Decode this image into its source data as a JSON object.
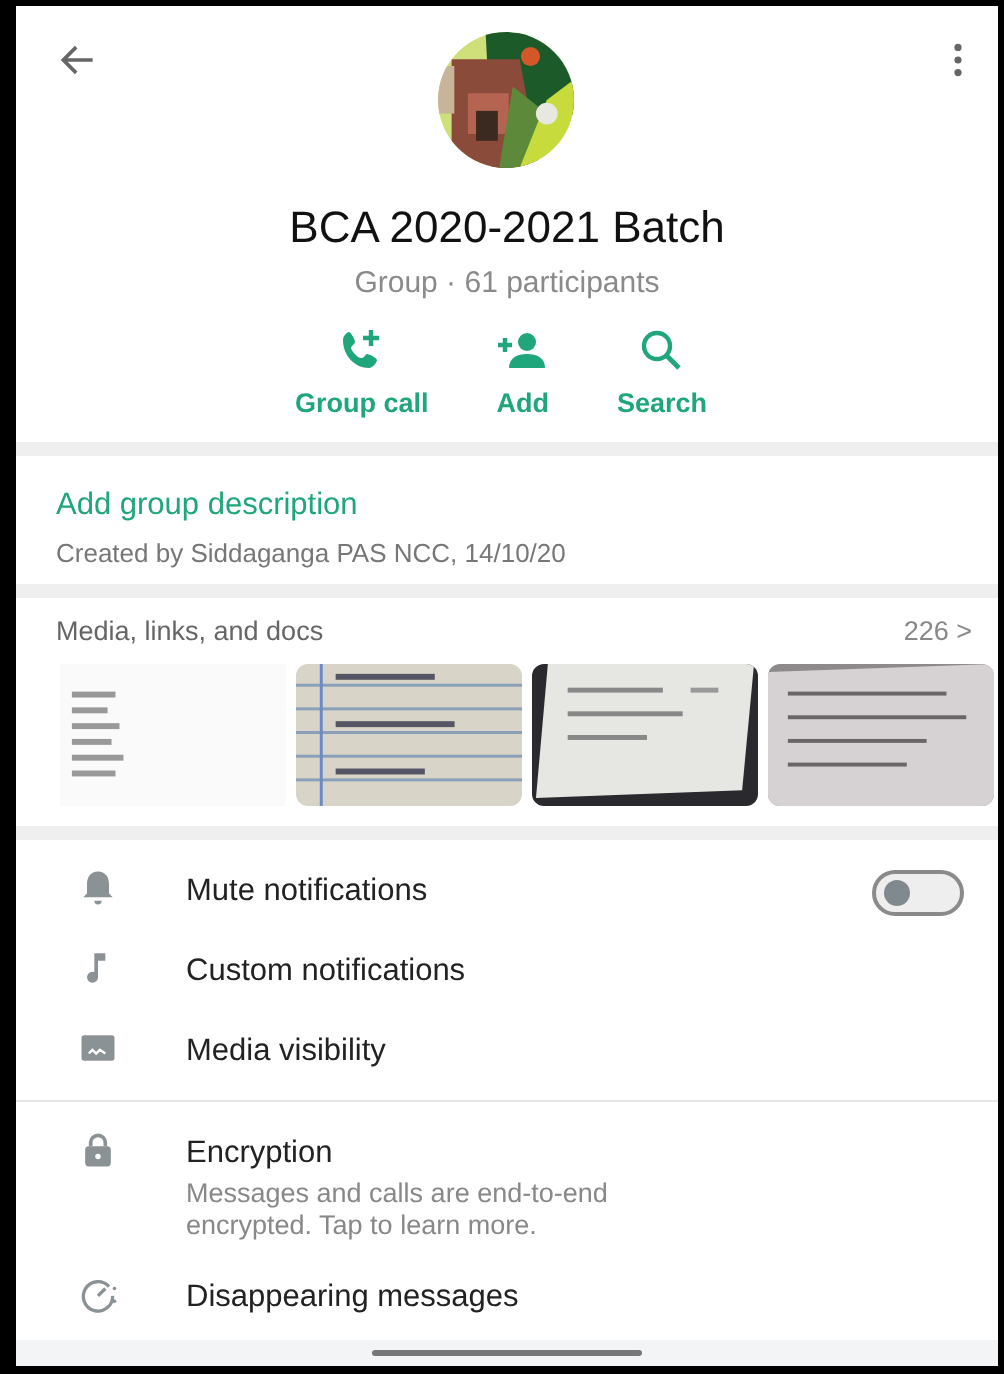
{
  "group": {
    "name": "BCA 2020-2021 Batch",
    "subtitle": "Group · 61 participants"
  },
  "actions": [
    {
      "kind": "call",
      "label": "Group call"
    },
    {
      "kind": "add",
      "label": "Add"
    },
    {
      "kind": "search",
      "label": "Search"
    }
  ],
  "description": {
    "link": "Add group description",
    "created": "Created by Siddaganga PAS NCC, 14/10/20"
  },
  "media": {
    "title": "Media, links, and docs",
    "count": "226 >"
  },
  "settings": [
    {
      "kind": "toggle",
      "label": "Mute notifications",
      "on": false
    },
    {
      "kind": "plain",
      "label": "Custom notifications"
    },
    {
      "kind": "plain",
      "label": "Media visibility"
    }
  ],
  "security": [
    {
      "kind": "detail",
      "label": "Encryption",
      "detail": "Messages and calls are end-to-end encrypted. Tap to learn more."
    },
    {
      "kind": "plain",
      "label": "Disappearing messages"
    }
  ]
}
